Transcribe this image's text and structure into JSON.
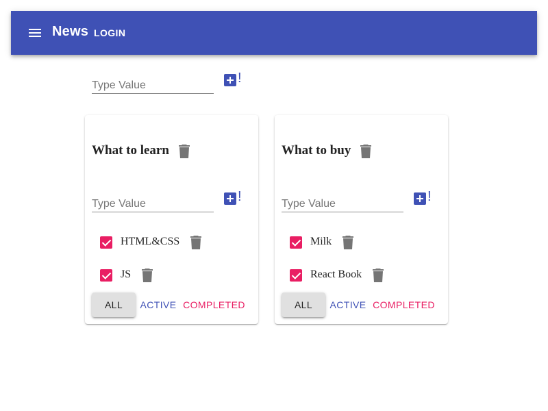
{
  "header": {
    "menu_icon": "menu-icon",
    "title": "News",
    "login_label": "LOGIN"
  },
  "new_list": {
    "placeholder": "Type Value",
    "add_icon": "add-box-icon",
    "add_suffix": "!"
  },
  "colors": {
    "primary": "#3f51b5",
    "secondary": "#e91e63",
    "icon_gray": "#757575"
  },
  "lists": [
    {
      "title": "What to learn",
      "input_placeholder": "Type Value",
      "add_suffix": "!",
      "tasks": [
        {
          "label": "HTML&CSS",
          "checked": true
        },
        {
          "label": "JS",
          "checked": true
        }
      ],
      "filters": {
        "all": "ALL",
        "active": "ACTIVE",
        "completed": "COMPLETED"
      }
    },
    {
      "title": "What to buy",
      "input_placeholder": "Type Value",
      "add_suffix": "!",
      "tasks": [
        {
          "label": "Milk",
          "checked": true
        },
        {
          "label": "React Book",
          "checked": true
        }
      ],
      "filters": {
        "all": "ALL",
        "active": "ACTIVE",
        "completed": "COMPLETED"
      }
    }
  ]
}
